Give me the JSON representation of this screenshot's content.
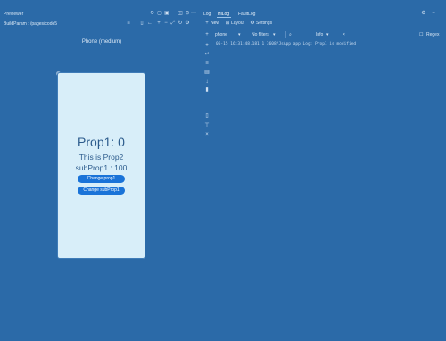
{
  "preview": {
    "title": "Previewer",
    "breadcrumb": "BuildParam : /pages/code5",
    "device": "Phone (medium)",
    "device_sub": "- - -"
  },
  "app": {
    "prop1_text": "Prop1: 0",
    "prop2_text": "This is Prop2",
    "subprop_text": "subProp1 : 100",
    "btn_change_prop1": "Change prop1",
    "btn_change_subprop": "Change subProp1"
  },
  "log_panel": {
    "tabs": [
      "Log",
      "HiLog",
      "FaultLog"
    ],
    "active_tab": "HiLog",
    "toolbar": {
      "new": "New",
      "layout": "Layout",
      "settings": "Settings"
    },
    "filters": {
      "device": "phone",
      "level": "No filters",
      "search": "",
      "level2": "Info",
      "regex": "Regex"
    },
    "log_line": "05-15 16:31:48.181 1 3608/JsApp app Log: Prop1 is modified"
  },
  "icons": {
    "toolbar_right": [
      "gear-icon",
      "minimize-icon"
    ],
    "side_icons": [
      "plus-icon",
      "wrap-icon",
      "filter-icon",
      "print-icon",
      "down-icon",
      "trash-icon",
      "copy-icon",
      "filter2-icon",
      "clear-icon"
    ]
  }
}
